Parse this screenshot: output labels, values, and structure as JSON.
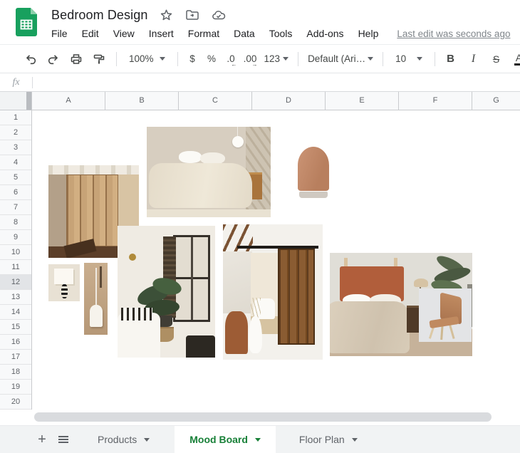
{
  "header": {
    "title": "Bedroom Design",
    "menu": [
      "File",
      "Edit",
      "View",
      "Insert",
      "Format",
      "Data",
      "Tools",
      "Add-ons",
      "Help"
    ],
    "last_edit": "Last edit was seconds ago",
    "icons": {
      "star": "star-outline",
      "folder": "move-to-folder",
      "cloud": "cloud-saved"
    }
  },
  "toolbar": {
    "zoom": "100%",
    "currency": "$",
    "percent": "%",
    "dec": ".0",
    "inc": ".00",
    "dec_arrow": "←",
    "inc_arrow": "→",
    "more_formats": "123",
    "font": "Default (Ari…",
    "font_size": "10",
    "bold": "B",
    "italic": "I",
    "strike": "S",
    "text_color": "A",
    "icons": [
      "undo",
      "redo",
      "print",
      "paint-format",
      "fill-color"
    ]
  },
  "formula_bar": {
    "label": "fx",
    "value": ""
  },
  "grid": {
    "columns": [
      "A",
      "B",
      "C",
      "D",
      "E",
      "F",
      "G"
    ],
    "rows": [
      "1",
      "2",
      "3",
      "4",
      "5",
      "6",
      "7",
      "8",
      "9",
      "10",
      "11",
      "12",
      "13",
      "14",
      "15",
      "16",
      "17",
      "18",
      "19",
      "20"
    ],
    "selected_row": "12"
  },
  "mood_board": {
    "images": [
      {
        "name": "wood-wardrobe",
        "description": "Attic room with slatted light-wood wardrobe doors"
      },
      {
        "name": "linen-bed",
        "description": "Bed with beige linen bedding, globe pendant light and wood side table"
      },
      {
        "name": "clay-diffuser",
        "description": "Terracotta ceramic aroma diffuser on white background"
      },
      {
        "name": "wall-sconce",
        "description": "Cream box wall sconce with black coiled stem"
      },
      {
        "name": "pendant-lamp",
        "description": "White pendant lamp hanging against wood panel"
      },
      {
        "name": "window-bedroom",
        "description": "White bedroom with shuttered window, potted plant and bed"
      },
      {
        "name": "barn-door-bath",
        "description": "Bathroom entry with rustic sliding barn door on black rail"
      },
      {
        "name": "rust-headboard-bedroom",
        "description": "Bedroom with rust upholstered headboard, beige duvet, floor lamp and plant"
      },
      {
        "name": "leather-lounge-chair",
        "description": "Tan leather sling lounge chair with light wood frame"
      }
    ]
  },
  "sheet_tabs": {
    "add_label": "+",
    "tabs": [
      {
        "label": "Products",
        "active": false
      },
      {
        "label": "Mood Board",
        "active": true
      },
      {
        "label": "Floor Plan",
        "active": false
      }
    ]
  },
  "colors": {
    "brand_green": "#0f9d58",
    "active_tab_green": "#188038",
    "accent_rust": "#b15e3b",
    "header_cell_bg": "#f8f9fa",
    "tabbar_bg": "#f1f3f4"
  }
}
